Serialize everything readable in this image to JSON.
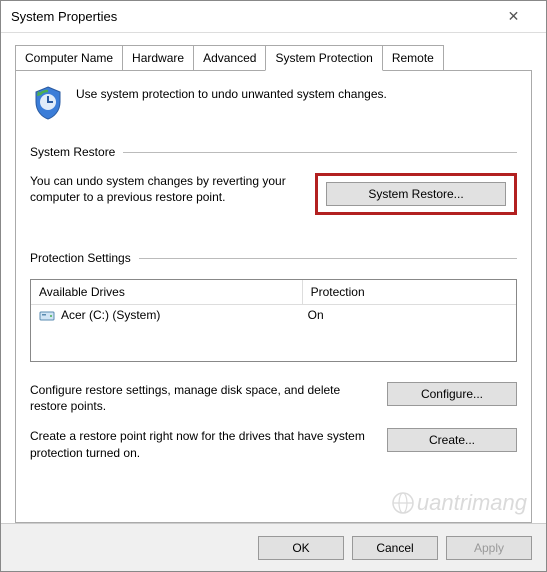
{
  "window": {
    "title": "System Properties"
  },
  "tabs": [
    {
      "label": "Computer Name"
    },
    {
      "label": "Hardware"
    },
    {
      "label": "Advanced"
    },
    {
      "label": "System Protection",
      "active": true
    },
    {
      "label": "Remote"
    }
  ],
  "intro": {
    "text": "Use system protection to undo unwanted system changes."
  },
  "sections": {
    "restore": {
      "header": "System Restore",
      "text": "You can undo system changes by reverting your computer to a previous restore point.",
      "button": "System Restore..."
    },
    "protection": {
      "header": "Protection Settings",
      "columns": {
        "drives": "Available Drives",
        "protection": "Protection"
      },
      "rows": [
        {
          "drive": "Acer (C:) (System)",
          "protection": "On"
        }
      ],
      "configure": {
        "text": "Configure restore settings, manage disk space, and delete restore points.",
        "button": "Configure..."
      },
      "create": {
        "text": "Create a restore point right now for the drives that have system protection turned on.",
        "button": "Create..."
      }
    }
  },
  "footer": {
    "ok": "OK",
    "cancel": "Cancel",
    "apply": "Apply"
  },
  "watermark": "uantrimang"
}
